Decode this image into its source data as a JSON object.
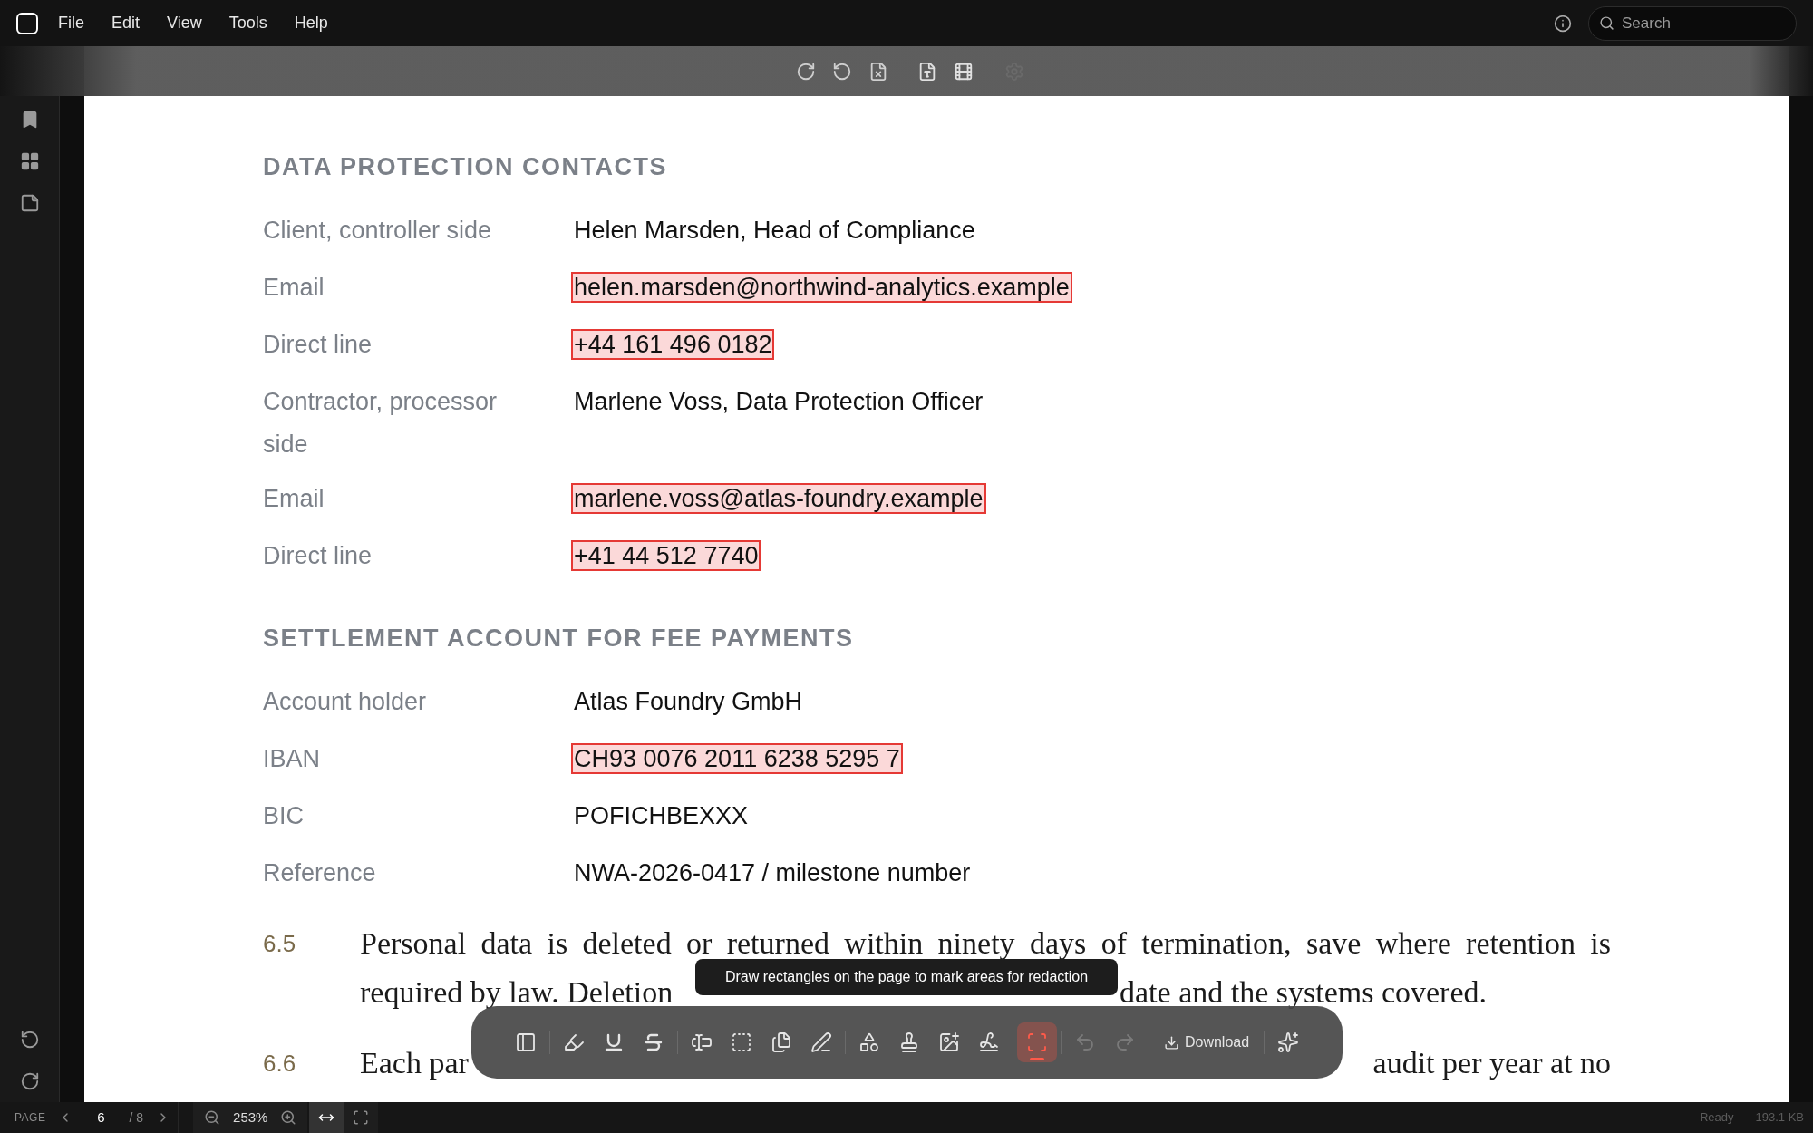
{
  "menu": [
    "File",
    "Edit",
    "View",
    "Tools",
    "Help"
  ],
  "search": {
    "placeholder": "Search"
  },
  "document": {
    "sections": [
      {
        "heading": "DATA PROTECTION CONTACTS",
        "rows": [
          {
            "label": "Client, controller side",
            "value": "Helen Marsden, Head of Compliance",
            "redacted": false
          },
          {
            "label": "Email",
            "value": "helen.marsden@northwind-analytics.example",
            "redacted": true
          },
          {
            "label": "Direct line",
            "value": "+44 161 496 0182",
            "redacted": true
          },
          {
            "label": "Contractor, processor side",
            "value": "Marlene Voss, Data Protection Officer",
            "redacted": false
          },
          {
            "label": "Email",
            "value": "marlene.voss@atlas-foundry.example",
            "redacted": true
          },
          {
            "label": "Direct line",
            "value": "+41 44 512 7740",
            "redacted": true
          }
        ]
      },
      {
        "heading": "SETTLEMENT ACCOUNT FOR FEE PAYMENTS",
        "rows": [
          {
            "label": "Account holder",
            "value": "Atlas Foundry GmbH",
            "redacted": false
          },
          {
            "label": "IBAN",
            "value": "CH93 0076 2011 6238 5295 7",
            "redacted": true
          },
          {
            "label": "BIC",
            "value": "POFICHBEXXX",
            "redacted": false
          },
          {
            "label": "Reference",
            "value": "NWA-2026-0417 / milestone number",
            "redacted": false
          }
        ]
      }
    ],
    "clauses": [
      {
        "kind": "covered",
        "number": "6.5",
        "line_1": "Personal data is deleted or returned within ninety days of termination, save where retention is",
        "line_2_start": "required by law. Deletion",
        "line_2_end": "date and the systems covered."
      },
      {
        "kind": "split",
        "number": "6.6",
        "text_start": "Each par",
        "text_end": "audit per year at no"
      }
    ]
  },
  "tooltip": "Draw rectangles on the page to mark areas for redaction",
  "toolbar": {
    "groups": [
      [
        {
          "kind": "panel",
          "selected": false,
          "disabled": false
        }
      ],
      [
        {
          "kind": "highlight",
          "selected": false,
          "disabled": false
        },
        {
          "kind": "underline",
          "selected": false,
          "disabled": false
        },
        {
          "kind": "strikethrough",
          "selected": false,
          "disabled": false
        }
      ],
      [
        {
          "kind": "textbox",
          "selected": false,
          "disabled": false
        },
        {
          "kind": "area",
          "selected": false,
          "disabled": false
        },
        {
          "kind": "notes",
          "selected": false,
          "disabled": false
        },
        {
          "kind": "pen",
          "selected": false,
          "disabled": false
        }
      ],
      [
        {
          "kind": "shapes",
          "selected": false,
          "disabled": false
        },
        {
          "kind": "stamp",
          "selected": false,
          "disabled": false
        },
        {
          "kind": "image",
          "selected": false,
          "disabled": false
        },
        {
          "kind": "signature",
          "selected": false,
          "disabled": false
        }
      ],
      [
        {
          "kind": "redact",
          "selected": true,
          "disabled": false
        }
      ],
      [
        {
          "kind": "undo",
          "selected": false,
          "disabled": true
        },
        {
          "kind": "redo",
          "selected": false,
          "disabled": true
        }
      ],
      [
        {
          "kind": "download",
          "label": "Download",
          "selected": false,
          "disabled": false
        }
      ],
      [
        {
          "kind": "ai",
          "selected": false,
          "disabled": false
        }
      ]
    ]
  },
  "status_bar": {
    "page_label": "PAGE",
    "page": "6",
    "page_total": "/ 8",
    "zoom": "253%",
    "fit_width_selected": true,
    "fit_page_selected": false,
    "status": "Ready",
    "file_size": "193.1 KB"
  }
}
